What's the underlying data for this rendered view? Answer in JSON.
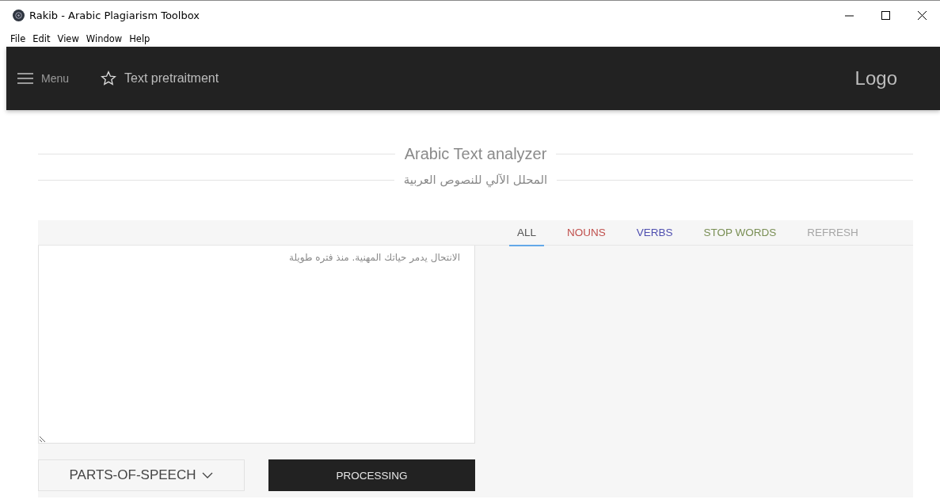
{
  "window": {
    "title": "Rakib - Arabic Plagiarism Toolbox"
  },
  "menu_bar": [
    "File",
    "Edit",
    "View",
    "Window",
    "Help"
  ],
  "header": {
    "menu_label": "Menu",
    "page_title": "Text pretraitment",
    "logo": "Logo"
  },
  "headings": {
    "title": "Arabic Text analyzer",
    "subtitle": "المحلل الآلي للنصوص العربية"
  },
  "tabs": [
    {
      "label": "ALL",
      "selected": true,
      "color": "#555555"
    },
    {
      "label": "NOUNS",
      "selected": false,
      "color": "#c0504d"
    },
    {
      "label": "VERBS",
      "selected": false,
      "color": "#4f4fb0"
    },
    {
      "label": "STOP WORDS",
      "selected": false,
      "color": "#7a8f55"
    },
    {
      "label": "REFRESH",
      "selected": false,
      "color": "#a6a6a6"
    }
  ],
  "input": {
    "placeholder": "الانتحال يدمر حياتك المهنية. منذ فتره طويلة"
  },
  "dropdown": {
    "value": "PARTS-OF-SPEECH"
  },
  "process_button": "PROCESSING"
}
